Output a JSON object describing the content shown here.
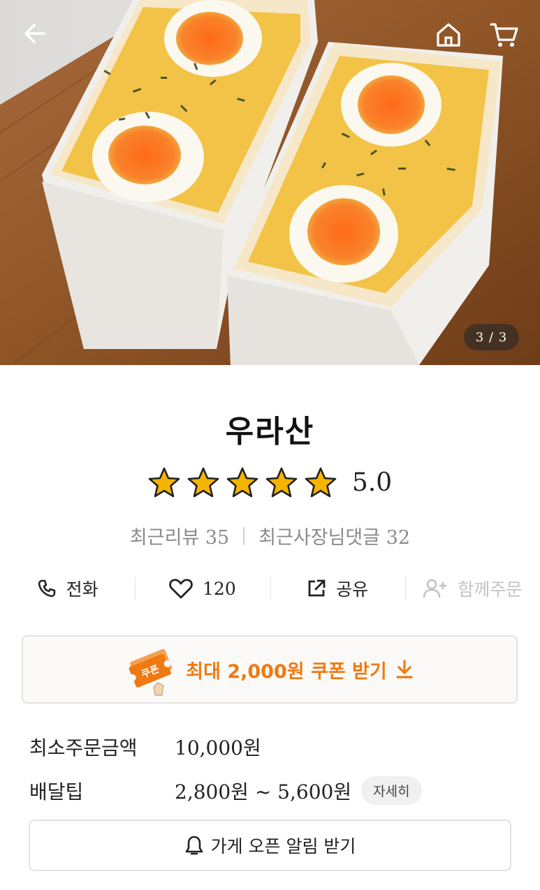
{
  "hero": {
    "pager": "3 / 3",
    "back_icon": "arrow-left-icon",
    "home_icon": "home-icon",
    "cart_icon": "cart-icon"
  },
  "store": {
    "name": "우라산",
    "rating": 5.0,
    "rating_text": "5.0",
    "stars_filled": 5,
    "stars_total": 5,
    "star_color": "#f5b400",
    "recent_reviews": "최근리뷰 35",
    "owner_comments": "최근사장님댓글 32"
  },
  "actions": [
    {
      "icon": "phone-icon",
      "label": "전화",
      "enabled": true
    },
    {
      "icon": "heart-icon",
      "label": "120",
      "enabled": true
    },
    {
      "icon": "share-icon",
      "label": "공유",
      "enabled": true
    },
    {
      "icon": "add-person-icon",
      "label": "함께주문",
      "enabled": false
    }
  ],
  "coupon": {
    "badge_text": "쿠폰",
    "label": "최대 2,000원 쿠폰 받기",
    "accent": "#f07a12"
  },
  "delivery": {
    "min_order_label": "최소주문금액",
    "min_order_value": "10,000원",
    "tip_label": "배달팁",
    "tip_value": "2,800원 ~ 5,600원",
    "detail_label": "자세히"
  },
  "notify": {
    "label": "가게 오픈 알림 받기"
  }
}
